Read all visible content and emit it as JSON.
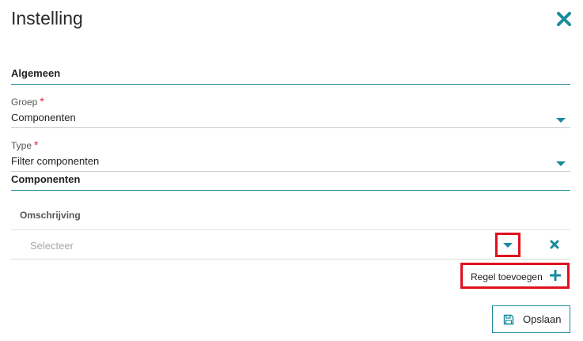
{
  "dialog": {
    "title": "Instelling",
    "close_icon": "close-icon"
  },
  "sections": {
    "general": "Algemeen",
    "components": "Componenten"
  },
  "fields": {
    "group": {
      "label": "Groep",
      "required_mark": "*",
      "value": "Componenten"
    },
    "type": {
      "label": "Type",
      "required_mark": "*",
      "value": "Filter componenten"
    }
  },
  "table": {
    "column_header": "Omschrijving",
    "rows": [
      {
        "placeholder": "Selecteer"
      }
    ]
  },
  "actions": {
    "add_row_label": "Regel toevoegen",
    "save_label": "Opslaan"
  },
  "colors": {
    "accent": "#1a8b9d",
    "required": "#e0213a",
    "highlight": "#e0101f"
  }
}
